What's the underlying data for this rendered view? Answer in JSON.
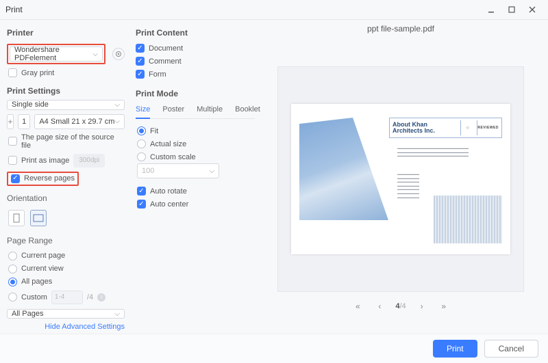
{
  "window": {
    "title": "Print"
  },
  "printer": {
    "section": "Printer",
    "selected": "Wondershare PDFelement",
    "gray_print": "Gray print"
  },
  "settings": {
    "section": "Print Settings",
    "sides": "Single side",
    "copies": "1",
    "paper": "A4 Small 21 x 29.7 cm",
    "source_size": "The page size of the source file",
    "print_as_image": "Print as image",
    "dpi": "300dpi",
    "reverse": "Reverse pages"
  },
  "orientation": {
    "section": "Orientation"
  },
  "range": {
    "section": "Page Range",
    "current_page": "Current page",
    "current_view": "Current view",
    "all_pages": "All pages",
    "custom": "Custom",
    "custom_hint": "1-4",
    "slash_total": "/4",
    "subset": "All Pages"
  },
  "advanced_link": "Hide Advanced Settings",
  "content": {
    "section": "Print Content",
    "document": "Document",
    "comment": "Comment",
    "form": "Form"
  },
  "mode": {
    "section": "Print Mode",
    "tabs": [
      "Size",
      "Poster",
      "Multiple",
      "Booklet"
    ],
    "fit": "Fit",
    "actual": "Actual size",
    "custom": "Custom scale",
    "scale_value": "100",
    "auto_rotate": "Auto rotate",
    "auto_center": "Auto center"
  },
  "preview": {
    "filename": "ppt file-sample.pdf",
    "doc_title": "About Khan Architects Inc.",
    "badge": "REVIEWED",
    "page_current": "4",
    "page_total": "/4"
  },
  "footer": {
    "print": "Print",
    "cancel": "Cancel"
  }
}
